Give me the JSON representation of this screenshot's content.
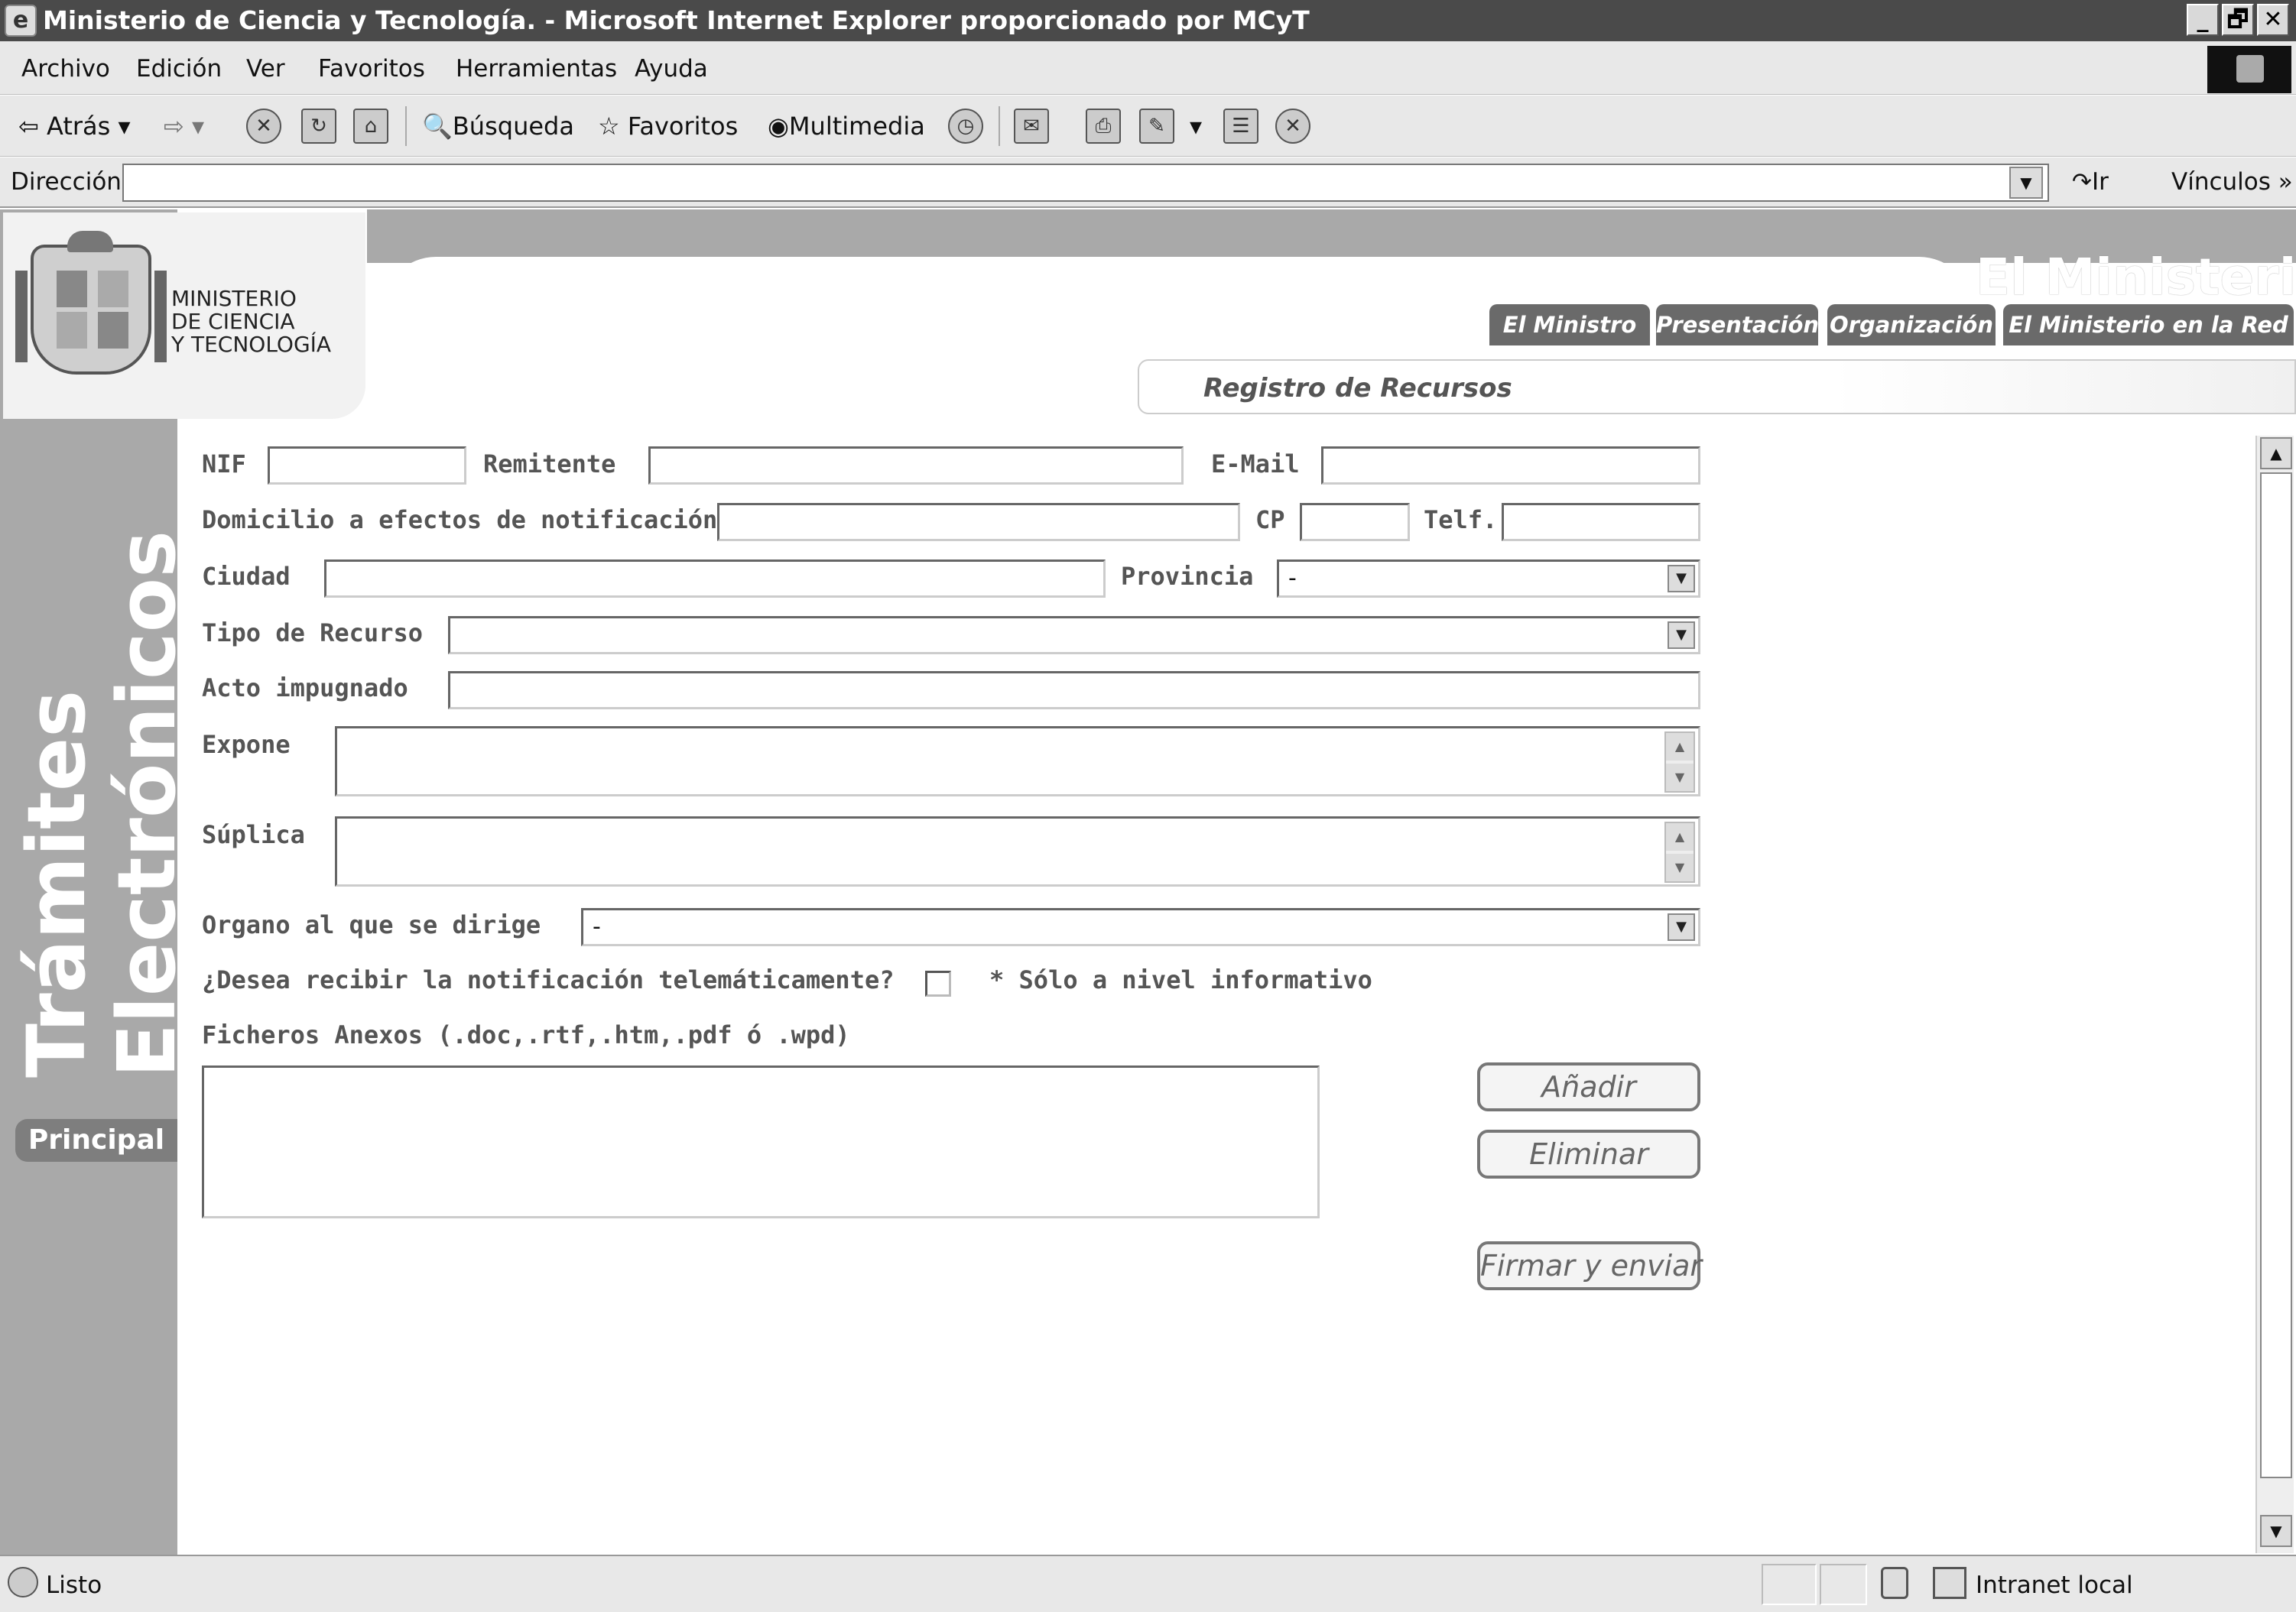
{
  "window": {
    "title": "Ministerio de Ciencia y Tecnología. - Microsoft Internet Explorer proporcionado por MCyT",
    "controls": [
      "_",
      "🗗",
      "✕"
    ]
  },
  "menubar": {
    "items": [
      "Archivo",
      "Edición",
      "Ver",
      "Favoritos",
      "Herramientas",
      "Ayuda"
    ]
  },
  "toolbar": {
    "back": "Atrás",
    "search": "Búsqueda",
    "favorites": "Favoritos",
    "media": "Multimedia"
  },
  "addressbar": {
    "label": "Dirección",
    "value": "",
    "go": "Ir",
    "links": "Vínculos »"
  },
  "header": {
    "logo_text": "MINISTERIO\nDE CIENCIA\nY TECNOLOGÍA",
    "section_big": "El Ministerio",
    "nav_tabs": [
      "El Ministro",
      "Presentación",
      "Organización",
      "El Ministerio en la Red"
    ],
    "page_title": "Registro de Recursos"
  },
  "sidebar": {
    "vertical_title_1": "Trámites",
    "vertical_title_2": "Electrónicos",
    "principal": "Principal"
  },
  "form": {
    "nif_label": "NIF",
    "remitente_label": "Remitente",
    "email_label": "E-Mail",
    "domicilio_label": "Domicilio a efectos de notificación",
    "cp_label": "CP",
    "telf_label": "Telf.",
    "ciudad_label": "Ciudad",
    "provincia_label": "Provincia",
    "provincia_value": "-",
    "tipo_label": "Tipo de Recurso",
    "tipo_value": "",
    "acto_label": "Acto impugnado",
    "expone_label": "Expone",
    "suplica_label": "Súplica",
    "organo_label": "Organo al que se dirige",
    "organo_value": "-",
    "notificacion_label": "¿Desea recibir la notificación telemáticamente?",
    "notificacion_note": "* Sólo a nivel informativo",
    "ficheros_label": "Ficheros Anexos (.doc,.rtf,.htm,.pdf ó .wpd)",
    "btn_add": "Añadir",
    "btn_remove": "Eliminar",
    "btn_submit": "Firmar y enviar"
  },
  "statusbar": {
    "status": "Listo",
    "zone": "Intranet local"
  },
  "colors": {
    "sidebar_grey": "#a9a9a9",
    "tab_grey": "#6a6a6a",
    "label_grey": "#555555"
  }
}
